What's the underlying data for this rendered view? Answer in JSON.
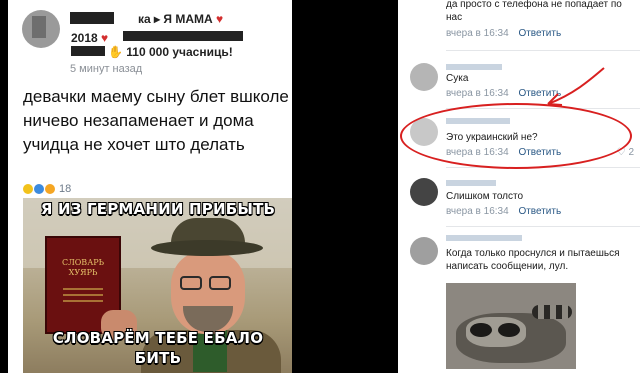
{
  "post": {
    "group_name_tail": "ка ▸ Я МАМА",
    "year_line": "2018",
    "subscribers": "110 000 учасниць!",
    "time": "5 минут назад",
    "text": "девачки маему сыну блет вшколе ничево незапаменает и дома учидца не хочет што делать",
    "reaction_count": "18",
    "meme": {
      "top_caption": "Я ИЗ ГЕРМАНИИ ПРИБЫТЬ",
      "bottom_caption_line1": "СЛОВАРЁМ ТЕБЕ ЕБАЛО",
      "bottom_caption_line2": "БИТЬ",
      "book_title_line1": "СЛОВАРЬ",
      "book_title_line2": "ХУЯРЬ"
    }
  },
  "comments": [
    {
      "text": "да просто с телефона не попадает по нас",
      "time": "вчера в 16:34",
      "reply": "Ответить"
    },
    {
      "text": "Сука",
      "time": "вчера в 16:34",
      "reply": "Ответить"
    },
    {
      "text": "Это украинский не?",
      "time": "вчера в 16:34",
      "reply": "Ответить",
      "likes": "2"
    },
    {
      "text": "Слишком толсто",
      "time": "вчера в 16:34",
      "reply": "Ответить"
    },
    {
      "text": "Когда только проснулся и пытаешься написать сообщении, лул.",
      "time": "",
      "reply": ""
    }
  ],
  "colors": {
    "annotation_red": "#d82020",
    "link_blue": "#2a5885",
    "meta_gray": "#8a96a3"
  }
}
